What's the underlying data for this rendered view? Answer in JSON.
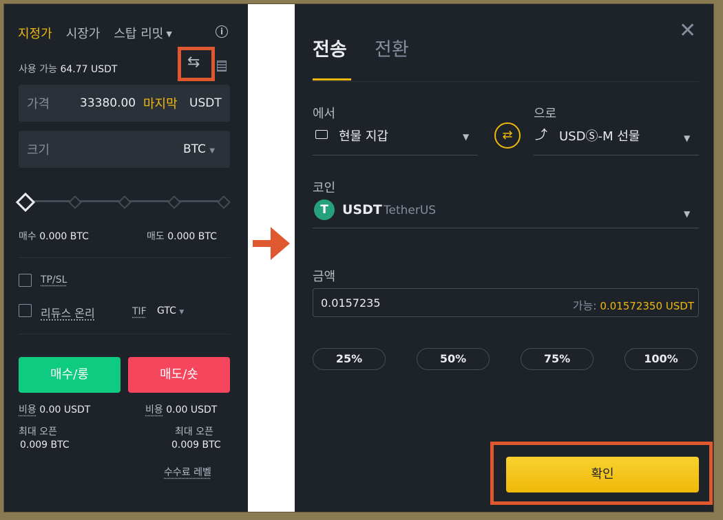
{
  "left_panel": {
    "order_tabs": {
      "limit": "지정가",
      "market": "시장가",
      "stop_limit": "스탑 리밋"
    },
    "info_icon": "i",
    "available": {
      "label": "사용 가능",
      "value": "64.77 USDT"
    },
    "transfer_icon": "⇆",
    "price": {
      "label": "가격",
      "value": "33380.00",
      "last": "마지막",
      "unit": "USDT"
    },
    "size": {
      "label": "크기",
      "unit": "BTC"
    },
    "buy_amount": {
      "label": "매수",
      "value": "0.000 BTC"
    },
    "sell_amount": {
      "label": "매도",
      "value": "0.000 BTC"
    },
    "tpsl_label": "TP/SL",
    "reduce_only_label": "리듀스 온리",
    "tif": {
      "label": "TIF",
      "value": "GTC"
    },
    "buy_button": "매수/롱",
    "sell_button": "매도/숏",
    "buy_cost": {
      "label": "비용",
      "value": "0.00 USDT"
    },
    "sell_cost": {
      "label": "비용",
      "value": "0.00 USDT"
    },
    "buy_max": {
      "label": "최대 오픈",
      "value": "0.009 BTC"
    },
    "sell_max": {
      "label": "최대 오픈",
      "value": "0.009 BTC"
    },
    "fee_level_link": "수수료 레벨"
  },
  "modal": {
    "tabs": {
      "transfer": "전송",
      "convert": "전환"
    },
    "close_icon": "✕",
    "from": {
      "label": "에서",
      "value": "현물 지갑"
    },
    "to": {
      "label": "으로",
      "value": "USDⓈ-M 선물"
    },
    "swap_icon": "⇄",
    "coin": {
      "label": "코인",
      "icon": "T",
      "symbol": "USDT",
      "name": "TetherUS"
    },
    "amount": {
      "label": "금액",
      "value": "0.0157235",
      "available_label": "가능:",
      "available_value": "0.01572350 USDT"
    },
    "percent_buttons": [
      "25%",
      "50%",
      "75%",
      "100%"
    ],
    "confirm_button": "확인"
  },
  "colors": {
    "accent": "#f0b90b",
    "buy": "#0ecb81",
    "sell": "#f6465d",
    "highlight": "#e0582f",
    "panel_bg": "#1e2329"
  }
}
